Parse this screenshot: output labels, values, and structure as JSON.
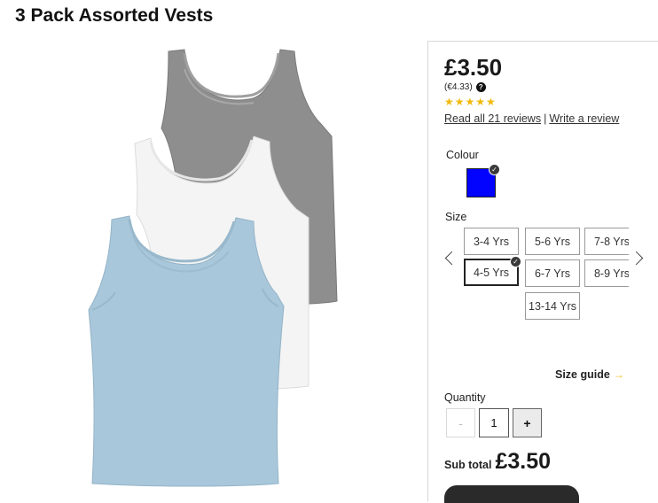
{
  "product": {
    "title": "3 Pack Assorted Vests"
  },
  "pricing": {
    "price": "£3.50",
    "euro_price": "(€4.33)",
    "help_glyph": "?",
    "stars": "★★★★★",
    "rating_stars": 5
  },
  "reviews": {
    "read_label": "Read all 21 reviews",
    "separator": "|",
    "write_label": "Write a review"
  },
  "colour": {
    "label": "Colour",
    "selected_color": "#0202ff"
  },
  "size": {
    "label": "Size",
    "options": [
      {
        "label": "3-4 Yrs"
      },
      {
        "label": "5-6 Yrs"
      },
      {
        "label": "7-8 Yrs"
      },
      {
        "label": "4-5 Yrs"
      },
      {
        "label": "6-7 Yrs"
      },
      {
        "label": "8-9 Yrs"
      },
      {
        "label": "13-14 Yrs"
      }
    ],
    "selected": "4-5 Yrs"
  },
  "size_guide": {
    "label": "Size guide",
    "arrow": "→"
  },
  "quantity": {
    "label": "Quantity",
    "minus": "-",
    "value": "1",
    "plus": "+"
  },
  "subtotal": {
    "label": "Sub total",
    "value": "£3.50"
  },
  "colors": {
    "star": "#f2b90c",
    "selected_swatch": "#0202ff"
  }
}
